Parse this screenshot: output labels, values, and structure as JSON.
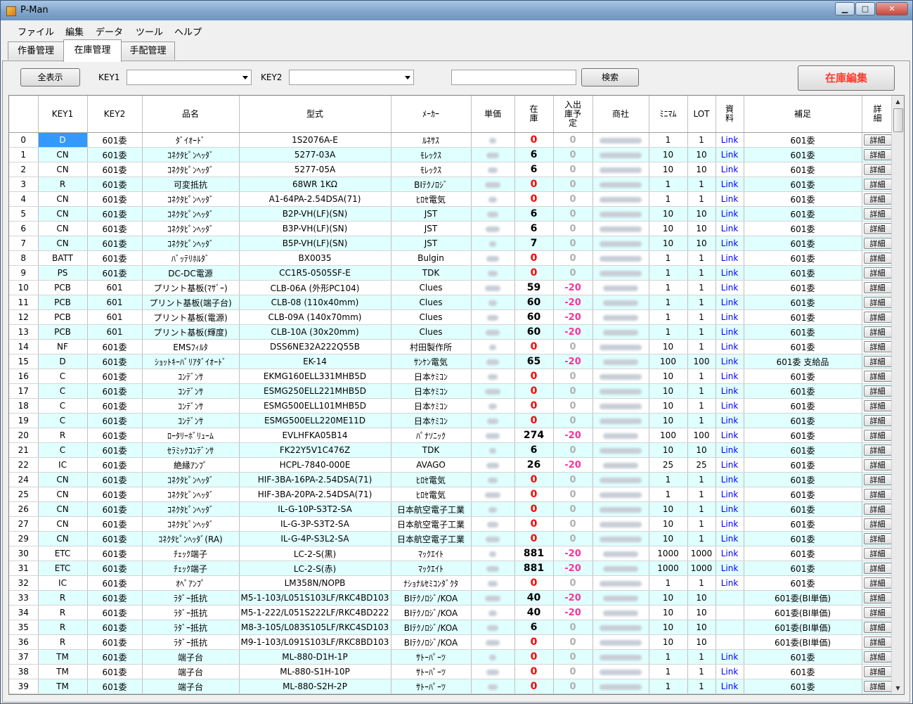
{
  "window": {
    "title": "P-Man",
    "controls": {
      "minimize": "▁",
      "maximize": "□",
      "close": "✕"
    }
  },
  "menu": [
    "ファイル",
    "編集",
    "データ",
    "ツール",
    "ヘルプ"
  ],
  "tabs": [
    "作番管理",
    "在庫管理",
    "手配管理"
  ],
  "active_tab": 1,
  "toolbar": {
    "show_all": "全表示",
    "key1_label": "KEY1",
    "key2_label": "KEY2",
    "search": "検索",
    "edit_stock": "在庫編集"
  },
  "columns": [
    "KEY1",
    "KEY2",
    "品名",
    "型式",
    "ﾒｰｶｰ",
    "単価",
    "在\n庫",
    "入出\n庫予\n定",
    "商社",
    "ﾐﾆﾏﾑ",
    "LOT",
    "資\n料",
    "補足",
    "詳\n細"
  ],
  "detail_label": "詳細",
  "link_label": "Link",
  "rows": [
    {
      "no": "0",
      "key1": "D",
      "key2": "601委",
      "name": "ﾀﾞｲｵｰﾄﾞ",
      "model": "1S2076A-E",
      "maker": "ﾙﾈｻｽ",
      "stock": "0",
      "plan": "0",
      "min": "1",
      "lot": "1",
      "link": true,
      "note": "601委"
    },
    {
      "no": "1",
      "key1": "CN",
      "key2": "601委",
      "name": "ｺﾈｸﾀﾋﾟﾝﾍｯﾀﾞ",
      "model": "5277-03A",
      "maker": "ﾓﾚｯｸｽ",
      "stock": "6",
      "plan": "0",
      "min": "10",
      "lot": "10",
      "link": true,
      "note": "601委"
    },
    {
      "no": "2",
      "key1": "CN",
      "key2": "601委",
      "name": "ｺﾈｸﾀﾋﾟﾝﾍｯﾀﾞ",
      "model": "5277-05A",
      "maker": "ﾓﾚｯｸｽ",
      "stock": "6",
      "plan": "0",
      "min": "10",
      "lot": "10",
      "link": true,
      "note": "601委"
    },
    {
      "no": "3",
      "key1": "R",
      "key2": "601委",
      "name": "可変抵抗",
      "model": "68WR 1KΩ",
      "maker": "BIﾃｸﾉﾛｼﾞ",
      "stock": "0",
      "plan": "0",
      "min": "1",
      "lot": "1",
      "link": true,
      "note": "601委"
    },
    {
      "no": "4",
      "key1": "CN",
      "key2": "601委",
      "name": "ｺﾈｸﾀﾋﾟﾝﾍｯﾀﾞ",
      "model": "A1-64PA-2.54DSA(71)",
      "maker": "ﾋﾛｾ電気",
      "stock": "0",
      "plan": "0",
      "min": "1",
      "lot": "1",
      "link": true,
      "note": "601委"
    },
    {
      "no": "5",
      "key1": "CN",
      "key2": "601委",
      "name": "ｺﾈｸﾀﾋﾟﾝﾍｯﾀﾞ",
      "model": "B2P-VH(LF)(SN)",
      "maker": "JST",
      "stock": "6",
      "plan": "0",
      "min": "10",
      "lot": "10",
      "link": true,
      "note": "601委"
    },
    {
      "no": "6",
      "key1": "CN",
      "key2": "601委",
      "name": "ｺﾈｸﾀﾋﾟﾝﾍｯﾀﾞ",
      "model": "B3P-VH(LF)(SN)",
      "maker": "JST",
      "stock": "6",
      "plan": "0",
      "min": "10",
      "lot": "10",
      "link": true,
      "note": "601委"
    },
    {
      "no": "7",
      "key1": "CN",
      "key2": "601委",
      "name": "ｺﾈｸﾀﾋﾟﾝﾍｯﾀﾞ",
      "model": "B5P-VH(LF)(SN)",
      "maker": "JST",
      "stock": "7",
      "plan": "0",
      "min": "10",
      "lot": "10",
      "link": true,
      "note": "601委"
    },
    {
      "no": "8",
      "key1": "BATT",
      "key2": "601委",
      "name": "ﾊﾞｯﾃﾘﾎﾙﾀﾞ",
      "model": "BX0035",
      "maker": "Bulgin",
      "stock": "0",
      "plan": "0",
      "min": "1",
      "lot": "1",
      "link": true,
      "note": "601委"
    },
    {
      "no": "9",
      "key1": "PS",
      "key2": "601委",
      "name": "DC-DC電源",
      "model": "CC1R5-0505SF-E",
      "maker": "TDK",
      "stock": "0",
      "plan": "0",
      "min": "1",
      "lot": "1",
      "link": true,
      "note": "601委"
    },
    {
      "no": "10",
      "key1": "PCB",
      "key2": "601",
      "name": "プリント基板(ﾏｻﾞｰ)",
      "model": "CLB-06A (外形PC104)",
      "maker": "Clues",
      "stock": "59",
      "plan": "-20",
      "min": "1",
      "lot": "1",
      "link": true,
      "note": "601委"
    },
    {
      "no": "11",
      "key1": "PCB",
      "key2": "601",
      "name": "プリント基板(端子台)",
      "model": "CLB-08 (110x40mm)",
      "maker": "Clues",
      "stock": "60",
      "plan": "-20",
      "min": "1",
      "lot": "1",
      "link": true,
      "note": "601委"
    },
    {
      "no": "12",
      "key1": "PCB",
      "key2": "601",
      "name": "プリント基板(電源)",
      "model": "CLB-09A (140x70mm)",
      "maker": "Clues",
      "stock": "60",
      "plan": "-20",
      "min": "1",
      "lot": "1",
      "link": true,
      "note": "601委"
    },
    {
      "no": "13",
      "key1": "PCB",
      "key2": "601",
      "name": "プリント基板(輝度)",
      "model": "CLB-10A (30x20mm)",
      "maker": "Clues",
      "stock": "60",
      "plan": "-20",
      "min": "1",
      "lot": "1",
      "link": true,
      "note": "601委"
    },
    {
      "no": "14",
      "key1": "NF",
      "key2": "601委",
      "name": "EMSﾌｨﾙﾀ",
      "model": "DSS6NE32A222Q55B",
      "maker": "村田製作所",
      "stock": "0",
      "plan": "0",
      "min": "10",
      "lot": "1",
      "link": true,
      "note": "601委"
    },
    {
      "no": "15",
      "key1": "D",
      "key2": "601委",
      "name": "ｼｮｯﾄｷｰﾊﾞﾘｱﾀﾞｲｵｰﾄﾞ",
      "model": "EK-14",
      "maker": "ｻﾝｹﾝ電気",
      "stock": "65",
      "plan": "-20",
      "min": "100",
      "lot": "100",
      "link": true,
      "note": "601委 支給品"
    },
    {
      "no": "16",
      "key1": "C",
      "key2": "601委",
      "name": "ｺﾝﾃﾞﾝｻ",
      "model": "EKMG160ELL331MHB5D",
      "maker": "日本ｹﾐｺﾝ",
      "stock": "0",
      "plan": "0",
      "min": "10",
      "lot": "1",
      "link": true,
      "note": "601委"
    },
    {
      "no": "17",
      "key1": "C",
      "key2": "601委",
      "name": "ｺﾝﾃﾞﾝｻ",
      "model": "ESMG250ELL221MHB5D",
      "maker": "日本ｹﾐｺﾝ",
      "stock": "0",
      "plan": "0",
      "min": "10",
      "lot": "1",
      "link": true,
      "note": "601委"
    },
    {
      "no": "18",
      "key1": "C",
      "key2": "601委",
      "name": "ｺﾝﾃﾞﾝｻ",
      "model": "ESMG500ELL101MHB5D",
      "maker": "日本ｹﾐｺﾝ",
      "stock": "0",
      "plan": "0",
      "min": "10",
      "lot": "1",
      "link": true,
      "note": "601委"
    },
    {
      "no": "19",
      "key1": "C",
      "key2": "601委",
      "name": "ｺﾝﾃﾞﾝｻ",
      "model": "ESMG500ELL220ME11D",
      "maker": "日本ｹﾐｺﾝ",
      "stock": "0",
      "plan": "0",
      "min": "10",
      "lot": "1",
      "link": true,
      "note": "601委"
    },
    {
      "no": "20",
      "key1": "R",
      "key2": "601委",
      "name": "ﾛｰﾀﾘｰﾎﾞﾘｭｰﾑ",
      "model": "EVLHFKA05B14",
      "maker": "ﾊﾟﾅｿﾆｯｸ",
      "stock": "274",
      "plan": "-20",
      "min": "100",
      "lot": "100",
      "link": true,
      "note": "601委"
    },
    {
      "no": "21",
      "key1": "C",
      "key2": "601委",
      "name": "ｾﾗﾐｯｸｺﾝﾃﾞﾝｻ",
      "model": "FK22Y5V1C476Z",
      "maker": "TDK",
      "stock": "6",
      "plan": "0",
      "min": "10",
      "lot": "10",
      "link": true,
      "note": "601委"
    },
    {
      "no": "22",
      "key1": "IC",
      "key2": "601委",
      "name": "絶縁ｱﾝﾌﾟ",
      "model": "HCPL-7840-000E",
      "maker": "AVAGO",
      "stock": "26",
      "plan": "-20",
      "min": "25",
      "lot": "25",
      "link": true,
      "note": "601委"
    },
    {
      "no": "24",
      "key1": "CN",
      "key2": "601委",
      "name": "ｺﾈｸﾀﾋﾟﾝﾍｯﾀﾞ",
      "model": "HIF-3BA-16PA-2.54DSA(71)",
      "maker": "ﾋﾛｾ電気",
      "stock": "0",
      "plan": "0",
      "min": "1",
      "lot": "1",
      "link": true,
      "note": "601委"
    },
    {
      "no": "25",
      "key1": "CN",
      "key2": "601委",
      "name": "ｺﾈｸﾀﾋﾟﾝﾍｯﾀﾞ",
      "model": "HIF-3BA-20PA-2.54DSA(71)",
      "maker": "ﾋﾛｾ電気",
      "stock": "0",
      "plan": "0",
      "min": "1",
      "lot": "1",
      "link": true,
      "note": "601委"
    },
    {
      "no": "26",
      "key1": "CN",
      "key2": "601委",
      "name": "ｺﾈｸﾀﾋﾟﾝﾍｯﾀﾞ",
      "model": "IL-G-10P-S3T2-SA",
      "maker": "日本航空電子工業",
      "stock": "0",
      "plan": "0",
      "min": "10",
      "lot": "1",
      "link": true,
      "note": "601委"
    },
    {
      "no": "27",
      "key1": "CN",
      "key2": "601委",
      "name": "ｺﾈｸﾀﾋﾟﾝﾍｯﾀﾞ",
      "model": "IL-G-3P-S3T2-SA",
      "maker": "日本航空電子工業",
      "stock": "0",
      "plan": "0",
      "min": "10",
      "lot": "1",
      "link": true,
      "note": "601委"
    },
    {
      "no": "29",
      "key1": "CN",
      "key2": "601委",
      "name": "ｺﾈｸﾀﾋﾟﾝﾍｯﾀﾞ(RA)",
      "model": "IL-G-4P-S3L2-SA",
      "maker": "日本航空電子工業",
      "stock": "0",
      "plan": "0",
      "min": "10",
      "lot": "1",
      "link": true,
      "note": "601委"
    },
    {
      "no": "30",
      "key1": "ETC",
      "key2": "601委",
      "name": "ﾁｪｯｸ端子",
      "model": "LC-2-S(黒)",
      "maker": "ﾏｯｸｴｲﾄ",
      "stock": "881",
      "plan": "-20",
      "min": "1000",
      "lot": "1000",
      "link": true,
      "note": "601委"
    },
    {
      "no": "31",
      "key1": "ETC",
      "key2": "601委",
      "name": "ﾁｪｯｸ端子",
      "model": "LC-2-S(赤)",
      "maker": "ﾏｯｸｴｲﾄ",
      "stock": "881",
      "plan": "-20",
      "min": "1000",
      "lot": "1000",
      "link": true,
      "note": "601委"
    },
    {
      "no": "32",
      "key1": "IC",
      "key2": "601委",
      "name": "ｵﾍﾟｱﾝﾌﾟ",
      "model": "LM358N/NOPB",
      "maker": "ﾅｼｮﾅﾙｾﾐｺﾝﾀﾞｸﾀ",
      "stock": "0",
      "plan": "0",
      "min": "1",
      "lot": "1",
      "link": true,
      "note": "601委"
    },
    {
      "no": "33",
      "key1": "R",
      "key2": "601委",
      "name": "ﾗﾀﾞｰ抵抗",
      "model": "M5-1-103/L051S103LF/RKC4BD103",
      "maker": "BIﾃｸﾉﾛｼﾞ/KOA",
      "stock": "40",
      "plan": "-20",
      "min": "10",
      "lot": "10",
      "link": false,
      "note": "601委(BI単価)"
    },
    {
      "no": "34",
      "key1": "R",
      "key2": "601委",
      "name": "ﾗﾀﾞｰ抵抗",
      "model": "M5-1-222/L051S222LF/RKC4BD222",
      "maker": "BIﾃｸﾉﾛｼﾞ/KOA",
      "stock": "40",
      "plan": "-20",
      "min": "10",
      "lot": "10",
      "link": false,
      "note": "601委(BI単価)"
    },
    {
      "no": "35",
      "key1": "R",
      "key2": "601委",
      "name": "ﾗﾀﾞｰ抵抗",
      "model": "M8-3-105/L083S105LF/RKC4SD103",
      "maker": "BIﾃｸﾉﾛｼﾞ/KOA",
      "stock": "6",
      "plan": "0",
      "min": "10",
      "lot": "10",
      "link": false,
      "note": "601委(BI単価)"
    },
    {
      "no": "36",
      "key1": "R",
      "key2": "601委",
      "name": "ﾗﾀﾞｰ抵抗",
      "model": "M9-1-103/L091S103LF/RKC8BD103",
      "maker": "BIﾃｸﾉﾛｼﾞ/KOA",
      "stock": "0",
      "plan": "0",
      "min": "10",
      "lot": "10",
      "link": false,
      "note": "601委(BI単価)"
    },
    {
      "no": "37",
      "key1": "TM",
      "key2": "601委",
      "name": "端子台",
      "model": "ML-880-D1H-1P",
      "maker": "ｻﾄｰﾊﾟｰﾂ",
      "stock": "0",
      "plan": "0",
      "min": "1",
      "lot": "1",
      "link": true,
      "note": "601委"
    },
    {
      "no": "38",
      "key1": "TM",
      "key2": "601委",
      "name": "端子台",
      "model": "ML-880-S1H-10P",
      "maker": "ｻﾄｰﾊﾟｰﾂ",
      "stock": "0",
      "plan": "0",
      "min": "1",
      "lot": "1",
      "link": true,
      "note": "601委"
    },
    {
      "no": "39",
      "key1": "TM",
      "key2": "601委",
      "name": "端子台",
      "model": "ML-880-S2H-2P",
      "maker": "ｻﾄｰﾊﾟｰﾂ",
      "stock": "0",
      "plan": "0",
      "min": "1",
      "lot": "1",
      "link": true,
      "note": "601委"
    }
  ]
}
